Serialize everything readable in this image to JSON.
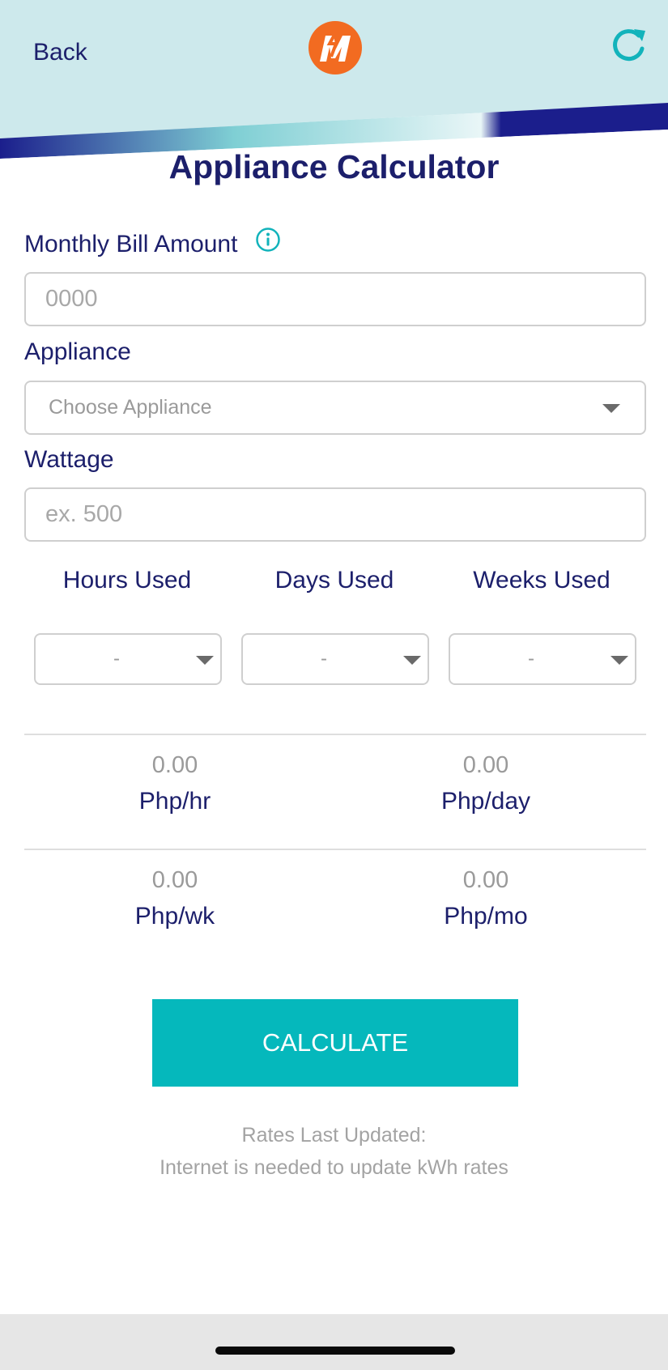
{
  "header": {
    "back_label": "Back",
    "logo_icon": "brand-bolt-m-logo",
    "refresh_icon": "refresh-icon",
    "bg_color": "#cde9ec",
    "stripe_dark": "#1b1e8c",
    "stripe_light": "#7fcfd4"
  },
  "title": "Appliance Calculator",
  "monthly_bill": {
    "label": "Monthly Bill Amount",
    "info_icon": "info-icon",
    "placeholder": "0000",
    "value": ""
  },
  "appliance": {
    "label": "Appliance",
    "selected": "Choose Appliance"
  },
  "wattage": {
    "label": "Wattage",
    "placeholder": "ex. 500",
    "value": ""
  },
  "usage": {
    "hours_label": "Hours Used",
    "days_label": "Days Used",
    "weeks_label": "Weeks Used",
    "hours_value": "-",
    "days_value": "-",
    "weeks_value": "-"
  },
  "results": {
    "per_hour": {
      "value": "0.00",
      "unit": "Php/hr"
    },
    "per_day": {
      "value": "0.00",
      "unit": "Php/day"
    },
    "per_week": {
      "value": "0.00",
      "unit": "Php/wk"
    },
    "per_month": {
      "value": "0.00",
      "unit": "Php/mo"
    }
  },
  "calculate_label": "CALCULATE",
  "rates_note": {
    "line1": "Rates Last Updated:",
    "line2": "Internet is needed to update kWh rates"
  },
  "colors": {
    "primary_text": "#1c1f6b",
    "accent": "#05b8bc",
    "muted": "#9a9a9a"
  }
}
